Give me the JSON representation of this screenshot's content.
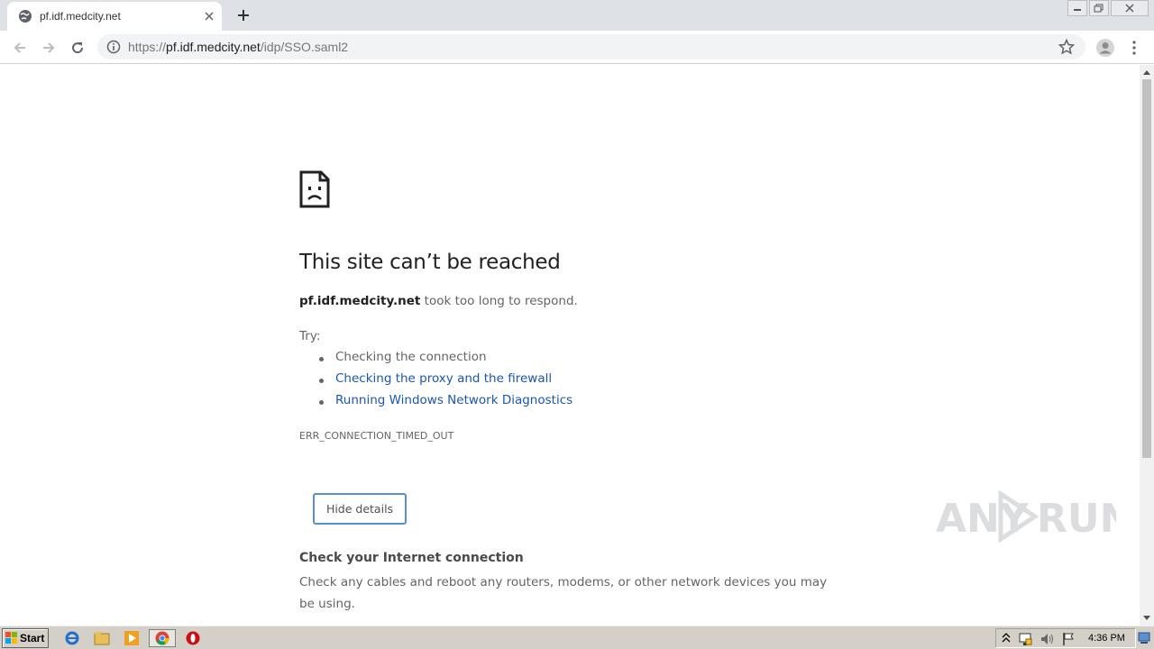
{
  "browser": {
    "tab": {
      "title": "pf.idf.medcity.net"
    },
    "address_bar": {
      "url_scheme": "https://",
      "url_host": "pf.idf.medcity.net",
      "url_path": "/idp/SSO.saml2"
    }
  },
  "error_page": {
    "heading": "This site can’t be reached",
    "host": "pf.idf.medcity.net",
    "description_suffix": " took too long to respond.",
    "try_label": "Try:",
    "suggestions": [
      "Checking the connection",
      "Checking the proxy and the firewall",
      "Running Windows Network Diagnostics"
    ],
    "error_code": "ERR_CONNECTION_TIMED_OUT",
    "details_button": "Hide details",
    "details_title": "Check your Internet connection",
    "details_body": "Check any cables and reboot any routers, modems, or other network devices you may be using."
  },
  "watermark": {
    "left_text": "ANY",
    "right_text": "RUN"
  },
  "taskbar": {
    "start_label": "Start",
    "clock": "4:36 PM",
    "icons": [
      "ie-icon",
      "explorer-icon",
      "media-player-icon",
      "chrome-icon",
      "opera-icon"
    ]
  },
  "colors": {
    "link": "#1a57b0",
    "button_border": "#5a8fd6",
    "tabstrip": "#dee1e6",
    "taskbar": "#d4d0c8"
  }
}
